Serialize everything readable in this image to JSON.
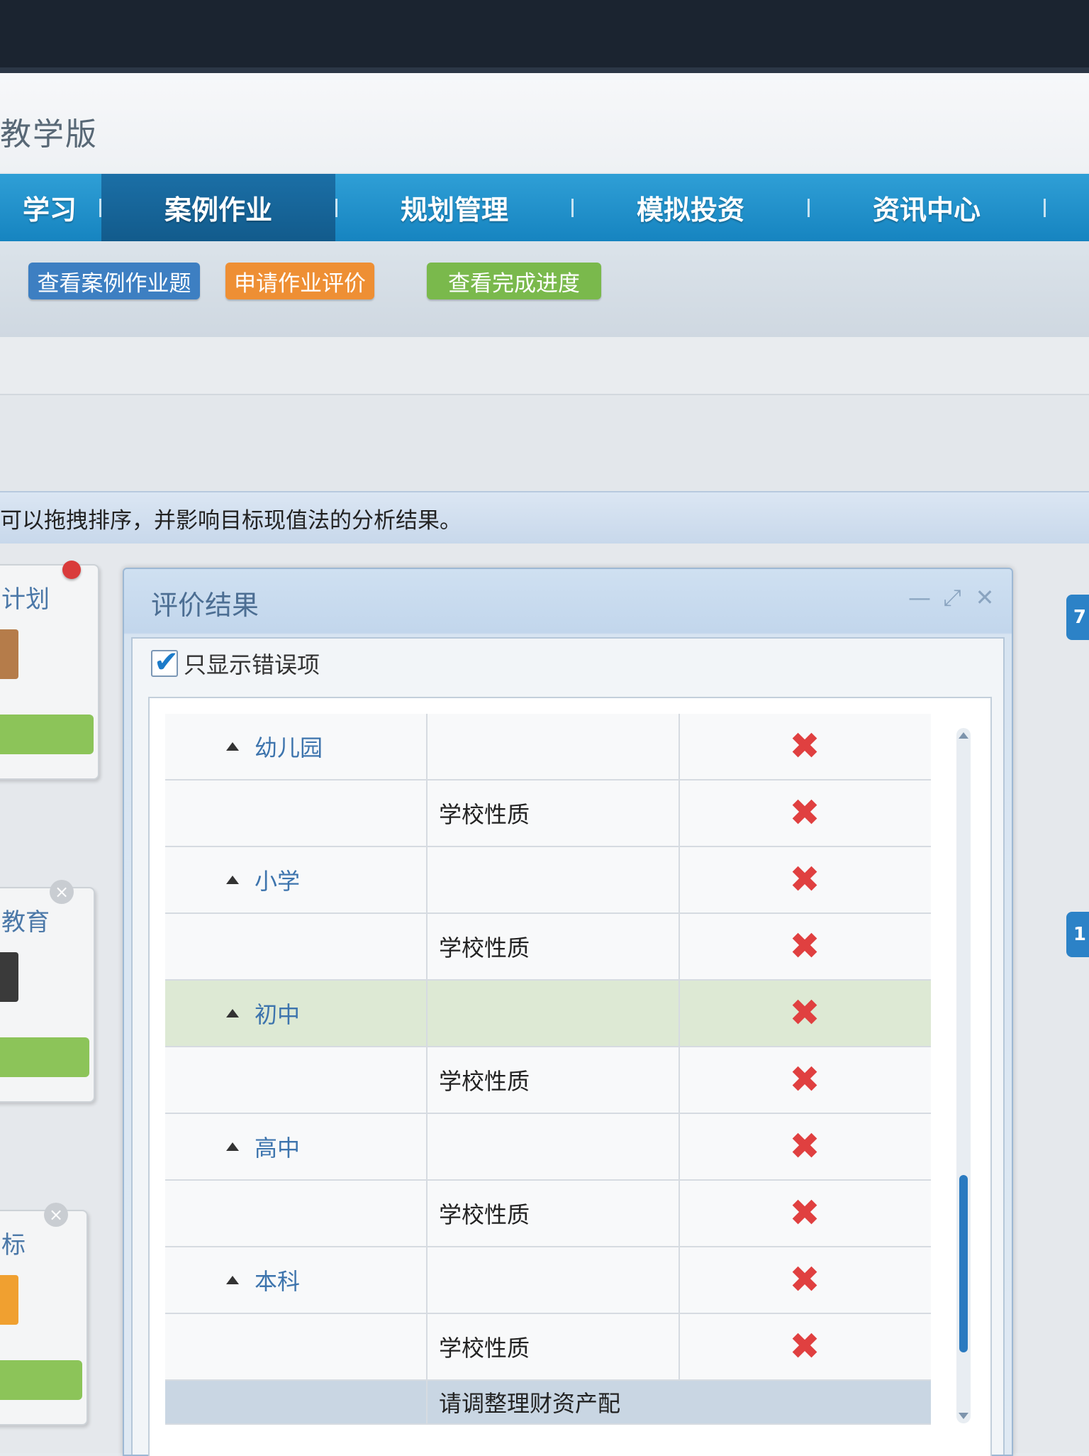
{
  "app": {
    "title": "教学版"
  },
  "nav": {
    "items": [
      {
        "label": "学习",
        "active": false
      },
      {
        "label": "案例作业",
        "active": true
      },
      {
        "label": "规划管理",
        "active": false
      },
      {
        "label": "模拟投资",
        "active": false
      },
      {
        "label": "资讯中心",
        "active": false
      }
    ]
  },
  "toolbar": {
    "view_cases": "查看案例作业题",
    "apply_eval": "申请作业评价",
    "view_progress": "查看完成进度",
    "colors": {
      "blue": "#3d7fc2",
      "orange": "#ee8f34",
      "green": "#7ab94c"
    }
  },
  "info": {
    "text": "可以拖拽排序，并影响目标现值法的分析结果。"
  },
  "cards": [
    {
      "title": "计划",
      "green_label": ""
    },
    {
      "title": "教育",
      "green_label": ""
    },
    {
      "title": "标",
      "green_label": ""
    }
  ],
  "right_badges": [
    "7",
    "1"
  ],
  "dialog": {
    "title": "评价结果",
    "filter_label": "只显示错误项",
    "filter_checked": true,
    "rows": [
      {
        "type": "group",
        "name": "幼儿园",
        "status": "✖"
      },
      {
        "type": "prop",
        "name": "学校性质",
        "status": "✖"
      },
      {
        "type": "group",
        "name": "小学",
        "status": "✖"
      },
      {
        "type": "prop",
        "name": "学校性质",
        "status": "✖"
      },
      {
        "type": "group",
        "name": "初中",
        "status": "✖",
        "highlight": true
      },
      {
        "type": "prop",
        "name": "学校性质",
        "status": "✖"
      },
      {
        "type": "group",
        "name": "高中",
        "status": "✖"
      },
      {
        "type": "prop",
        "name": "学校性质",
        "status": "✖"
      },
      {
        "type": "group",
        "name": "本科",
        "status": "✖"
      },
      {
        "type": "prop",
        "name": "学校性质",
        "status": "✖"
      }
    ],
    "footer_text": "请调整理财资产配"
  }
}
